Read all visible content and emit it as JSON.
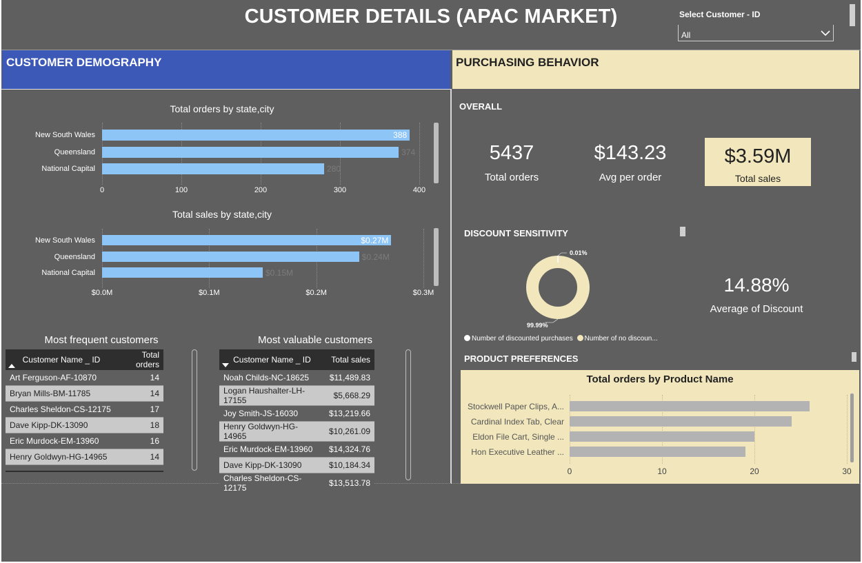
{
  "page": {
    "title": "CUSTOMER DETAILS (APAC MARKET)"
  },
  "selector": {
    "label": "Select Customer - ID",
    "value": "All"
  },
  "sections": {
    "demography": "CUSTOMER DEMOGRAPHY",
    "purchasing": "PURCHASING BEHAVIOR",
    "overall": "OVERALL",
    "discount": "DISCOUNT SENSITIVITY",
    "product": "PRODUCT PREFERENCES"
  },
  "orders_by_state": {
    "title": "Total orders by state,city",
    "ticks": [
      "0",
      "100",
      "200",
      "300",
      "400"
    ]
  },
  "sales_by_state": {
    "title": "Total sales by state,city",
    "ticks": [
      "$0.0M",
      "$0.1M",
      "$0.2M",
      "$0.3M"
    ]
  },
  "kpis": {
    "total_orders": {
      "value": "5437",
      "label": "Total orders"
    },
    "avg_order": {
      "value": "$143.23",
      "label": "Avg per order"
    },
    "total_sales": {
      "value": "$3.59M",
      "label": "Total sales"
    },
    "avg_discount": {
      "value": "14.88%",
      "label": "Average of Discount"
    }
  },
  "donut": {
    "small_label": "0.01%",
    "large_label": "99.99%",
    "legend": [
      "Number of discounted purchases",
      "Number of no discoun..."
    ],
    "colors": {
      "discounted": "#ffffff",
      "no_discount": "#f1e6bc"
    }
  },
  "frequent": {
    "title": "Most frequent customers",
    "columns": [
      "Customer Name _ ID",
      "Total orders"
    ],
    "rows": [
      [
        "Art Ferguson-AF-10870",
        "14"
      ],
      [
        "Bryan Mills-BM-11785",
        "14"
      ],
      [
        "Charles Sheldon-CS-12175",
        "17"
      ],
      [
        "Dave Kipp-DK-13090",
        "18"
      ],
      [
        "Eric Murdock-EM-13960",
        "16"
      ],
      [
        "Henry Goldwyn-HG-14965",
        "14"
      ]
    ]
  },
  "valuable": {
    "title": "Most valuable customers",
    "columns": [
      "Customer Name _ ID",
      "Total sales"
    ],
    "rows": [
      [
        "Noah Childs-NC-18625",
        "$11,489.83"
      ],
      [
        "Logan Haushalter-LH-17155",
        "$5,668.29"
      ],
      [
        "Joy Smith-JS-16030",
        "$13,219.66"
      ],
      [
        "Henry Goldwyn-HG-14965",
        "$10,261.09"
      ],
      [
        "Eric Murdock-EM-13960",
        "$14,324.76"
      ],
      [
        "Dave Kipp-DK-13090",
        "$10,184.34"
      ],
      [
        "Charles Sheldon-CS-12175",
        "$13,513.78"
      ]
    ]
  },
  "product": {
    "title": "Total orders by Product Name",
    "ticks": [
      "0",
      "10",
      "20",
      "30"
    ]
  },
  "chart_data": [
    {
      "type": "bar",
      "title": "Total orders by state,city",
      "orientation": "horizontal",
      "categories": [
        "New South Wales",
        "Queensland",
        "National Capital"
      ],
      "values": [
        388,
        374,
        280
      ],
      "value_labels": [
        "388",
        "374",
        "280"
      ],
      "xlim": [
        0,
        420
      ],
      "grid": true
    },
    {
      "type": "bar",
      "title": "Total sales by state,city",
      "orientation": "horizontal",
      "categories": [
        "New South Wales",
        "Queensland",
        "National Capital"
      ],
      "values": [
        0.27,
        0.24,
        0.15
      ],
      "value_labels": [
        "$0.27M",
        "$0.24M",
        "$0.15M"
      ],
      "xlim": [
        0,
        0.31
      ],
      "grid": true
    },
    {
      "type": "pie",
      "title": "",
      "categories": [
        "Number of discounted purchases",
        "Number of no discoun..."
      ],
      "values": [
        0.01,
        99.99
      ]
    },
    {
      "type": "bar",
      "title": "Total orders by Product Name",
      "orientation": "horizontal",
      "categories": [
        "Stockwell Paper Clips, A...",
        "Cardinal Index Tab, Clear",
        "Eldon File Cart, Single ...",
        "Hon Executive Leather ..."
      ],
      "values": [
        26,
        24,
        20,
        19
      ],
      "xlim": [
        0,
        30
      ],
      "grid": true
    }
  ]
}
